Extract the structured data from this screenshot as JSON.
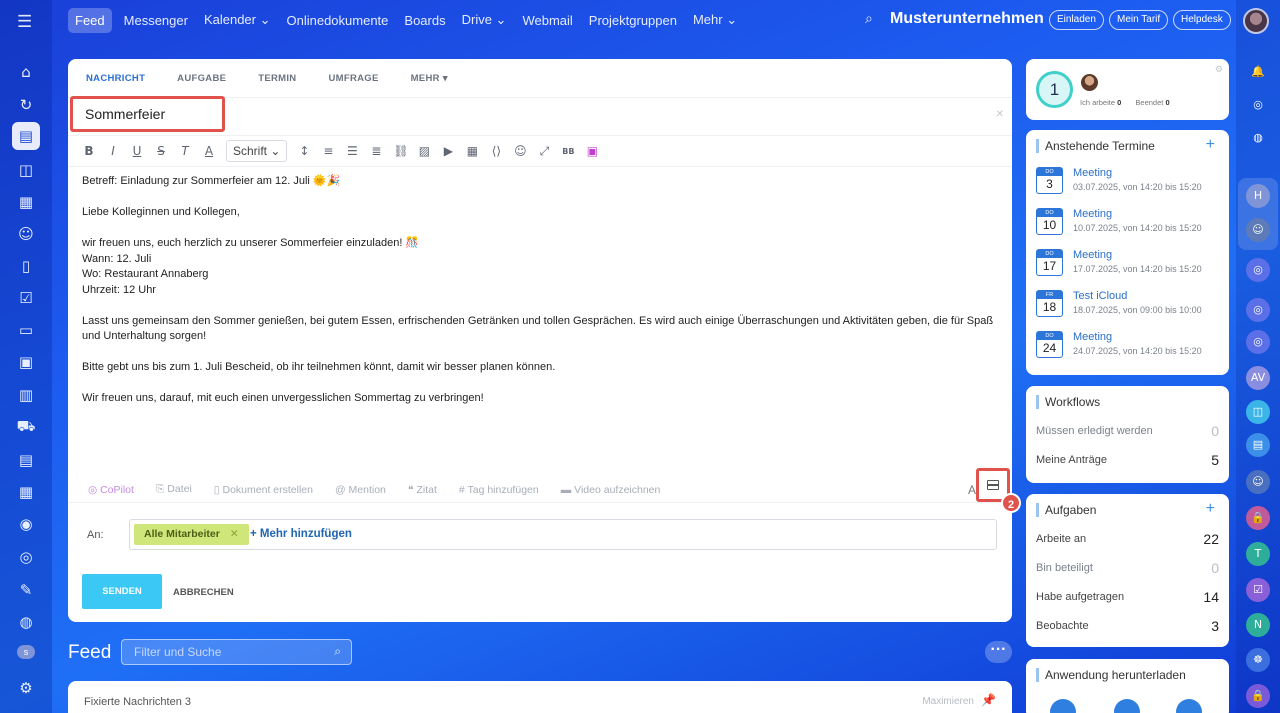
{
  "app": {
    "left_icons": [
      "home-icon",
      "activity-icon",
      "feed-icon",
      "chat-icon",
      "calendar-icon",
      "users-icon",
      "document-icon",
      "tasks-icon",
      "drive-icon",
      "board-icon",
      "analytics-icon",
      "cart-icon",
      "contact-card-icon",
      "planner-icon",
      "robot-icon",
      "target-icon",
      "sign-icon",
      "support-icon"
    ],
    "left_avatar_initial": "s",
    "left_settings_icon": "gear-icon"
  },
  "nav": {
    "items": [
      "Feed",
      "Messenger",
      "Kalender ⌄",
      "Onlinedokumente",
      "Boards",
      "Drive ⌄",
      "Webmail",
      "Projektgruppen",
      "Mehr ⌄"
    ],
    "org_name": "Musterunternehmen",
    "pills": [
      "Einladen",
      "Mein Tarif",
      "Helpdesk"
    ]
  },
  "composer": {
    "tabs": [
      "NACHRICHT",
      "AUFGABE",
      "TERMIN",
      "UMFRAGE",
      "MEHR ▾"
    ],
    "title_value": "Sommerfeier",
    "font_select": "Schrift",
    "body": [
      "Betreff: Einladung zur Sommerfeier am 12. Juli 🌞🎉",
      "Liebe Kolleginnen und Kollegen,",
      "wir freuen uns, euch herzlich zu unserer Sommerfeier einzuladen! 🎊",
      "Wann: 12. Juli",
      "Wo: Restaurant Annaberg",
      "Uhrzeit: 12 Uhr",
      "Lasst uns gemeinsam den Sommer genießen, bei gutem Essen, erfrischenden Getränken und tollen Gesprächen. Es wird auch einige Überraschungen und Aktivitäten geben, die für Spaß und Unterhaltung sorgen!",
      "Bitte gebt uns bis zum 1. Juli Bescheid, ob ihr teilnehmen könnt, damit wir besser planen können.",
      "Wir freuen uns, darauf, mit euch einen unvergesslichen Sommertag zu verbringen!"
    ],
    "attach": [
      "CoPilot",
      "Datei",
      "Dokument erstellen",
      "Mention",
      "Zitat",
      "Tag hinzufügen",
      "Video aufzeichnen"
    ],
    "ai_label": "A",
    "step_badge": "2",
    "recipients_label": "An:",
    "recipient_chip": "Alle Mitarbeiter",
    "add_more": "+ Mehr hinzufügen",
    "send": "SENDEN",
    "cancel": "ABBRECHEN"
  },
  "feed": {
    "title": "Feed",
    "search_placeholder": "Filter und Suche",
    "pinned_label": "Fixierte Nachrichten 3",
    "maximize": "Maximieren"
  },
  "status": {
    "count": "1",
    "working_label": "Ich arbeite",
    "working_value": "0",
    "done_label": "Beendet",
    "done_value": "0"
  },
  "termine": {
    "title": "Anstehende Termine",
    "events": [
      {
        "dow": "DO",
        "day": "3",
        "title": "Meeting",
        "time": "03.07.2025, von 14:20 bis 15:20"
      },
      {
        "dow": "DO",
        "day": "10",
        "title": "Meeting",
        "time": "10.07.2025, von 14:20 bis 15:20"
      },
      {
        "dow": "DO",
        "day": "17",
        "title": "Meeting",
        "time": "17.07.2025, von 14:20 bis 15:20"
      },
      {
        "dow": "FR",
        "day": "18",
        "title": "Test iCloud",
        "time": "18.07.2025, von 09:00 bis 10:00"
      },
      {
        "dow": "DO",
        "day": "24",
        "title": "Meeting",
        "time": "24.07.2025, von 14:20 bis 15:20"
      }
    ]
  },
  "workflows": {
    "title": "Workflows",
    "rows": [
      {
        "label": "Müssen erledigt werden",
        "value": "0"
      },
      {
        "label": "Meine Anträge",
        "value": "5"
      }
    ]
  },
  "aufgaben": {
    "title": "Aufgaben",
    "rows": [
      {
        "label": "Arbeite an",
        "value": "22"
      },
      {
        "label": "Bin beteiligt",
        "value": "0"
      },
      {
        "label": "Habe aufgetragen",
        "value": "14"
      },
      {
        "label": "Beobachte",
        "value": "3"
      }
    ]
  },
  "app_download": {
    "title": "Anwendung herunterladen"
  },
  "rail": {
    "initials": [
      "H",
      "AV",
      "T",
      "N"
    ]
  },
  "colors": {
    "accent": "#2b6fd6",
    "send": "#3bc8f5",
    "highlight": "#e0524b",
    "chip": "#cfe67a"
  }
}
